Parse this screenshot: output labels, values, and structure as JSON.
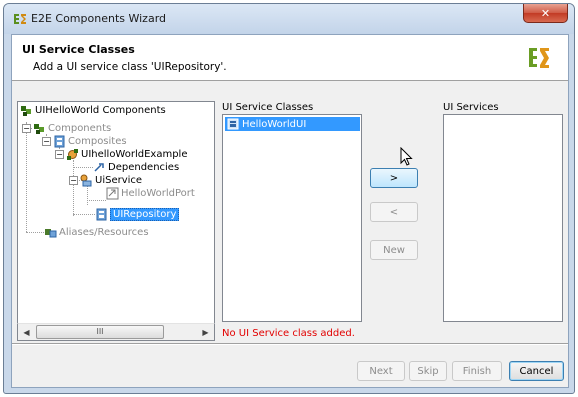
{
  "window": {
    "title": "E2E Components Wizard",
    "close_glyph": "✕"
  },
  "header": {
    "title": "UI Service Classes",
    "description": "Add a UI service class 'UIRepository'.",
    "logo": "e2e-logo"
  },
  "tree": {
    "nodes": [
      {
        "label": "UIHelloWorld Components",
        "icon": "components-root-icon"
      },
      {
        "label": "Components",
        "icon": "components-icon",
        "disabled": true
      },
      {
        "label": "Composites",
        "icon": "composites-icon",
        "disabled": true
      },
      {
        "label": "UIhelloWorldExample",
        "icon": "composite-component-icon"
      },
      {
        "label": "Dependencies",
        "icon": "dependencies-icon"
      },
      {
        "label": "UiService",
        "icon": "ui-service-icon"
      },
      {
        "label": "HelloWorldPort",
        "icon": "port-icon",
        "disabled": true
      },
      {
        "label": "UIRepository",
        "icon": "repository-icon",
        "selected": true
      },
      {
        "label": "Aliases/Resources",
        "icon": "aliases-icon",
        "disabled": true
      }
    ],
    "scroll_grip": "III"
  },
  "ui_service_classes": {
    "label": "UI Service Classes",
    "items": [
      {
        "label": "HelloWorldUI",
        "icon": "ui-class-icon"
      }
    ]
  },
  "ui_services": {
    "label": "UI Services",
    "items": []
  },
  "transfer_buttons": {
    "add": ">",
    "remove": "<",
    "new": "New"
  },
  "status_message": "No UI Service class added.",
  "footer": {
    "next": "Next",
    "skip": "Skip",
    "finish": "Finish",
    "cancel": "Cancel"
  },
  "colors": {
    "selection": "#3399ff",
    "error_text": "#e20000",
    "title_bar": "#c9d8ea",
    "close_button": "#c23a24"
  }
}
